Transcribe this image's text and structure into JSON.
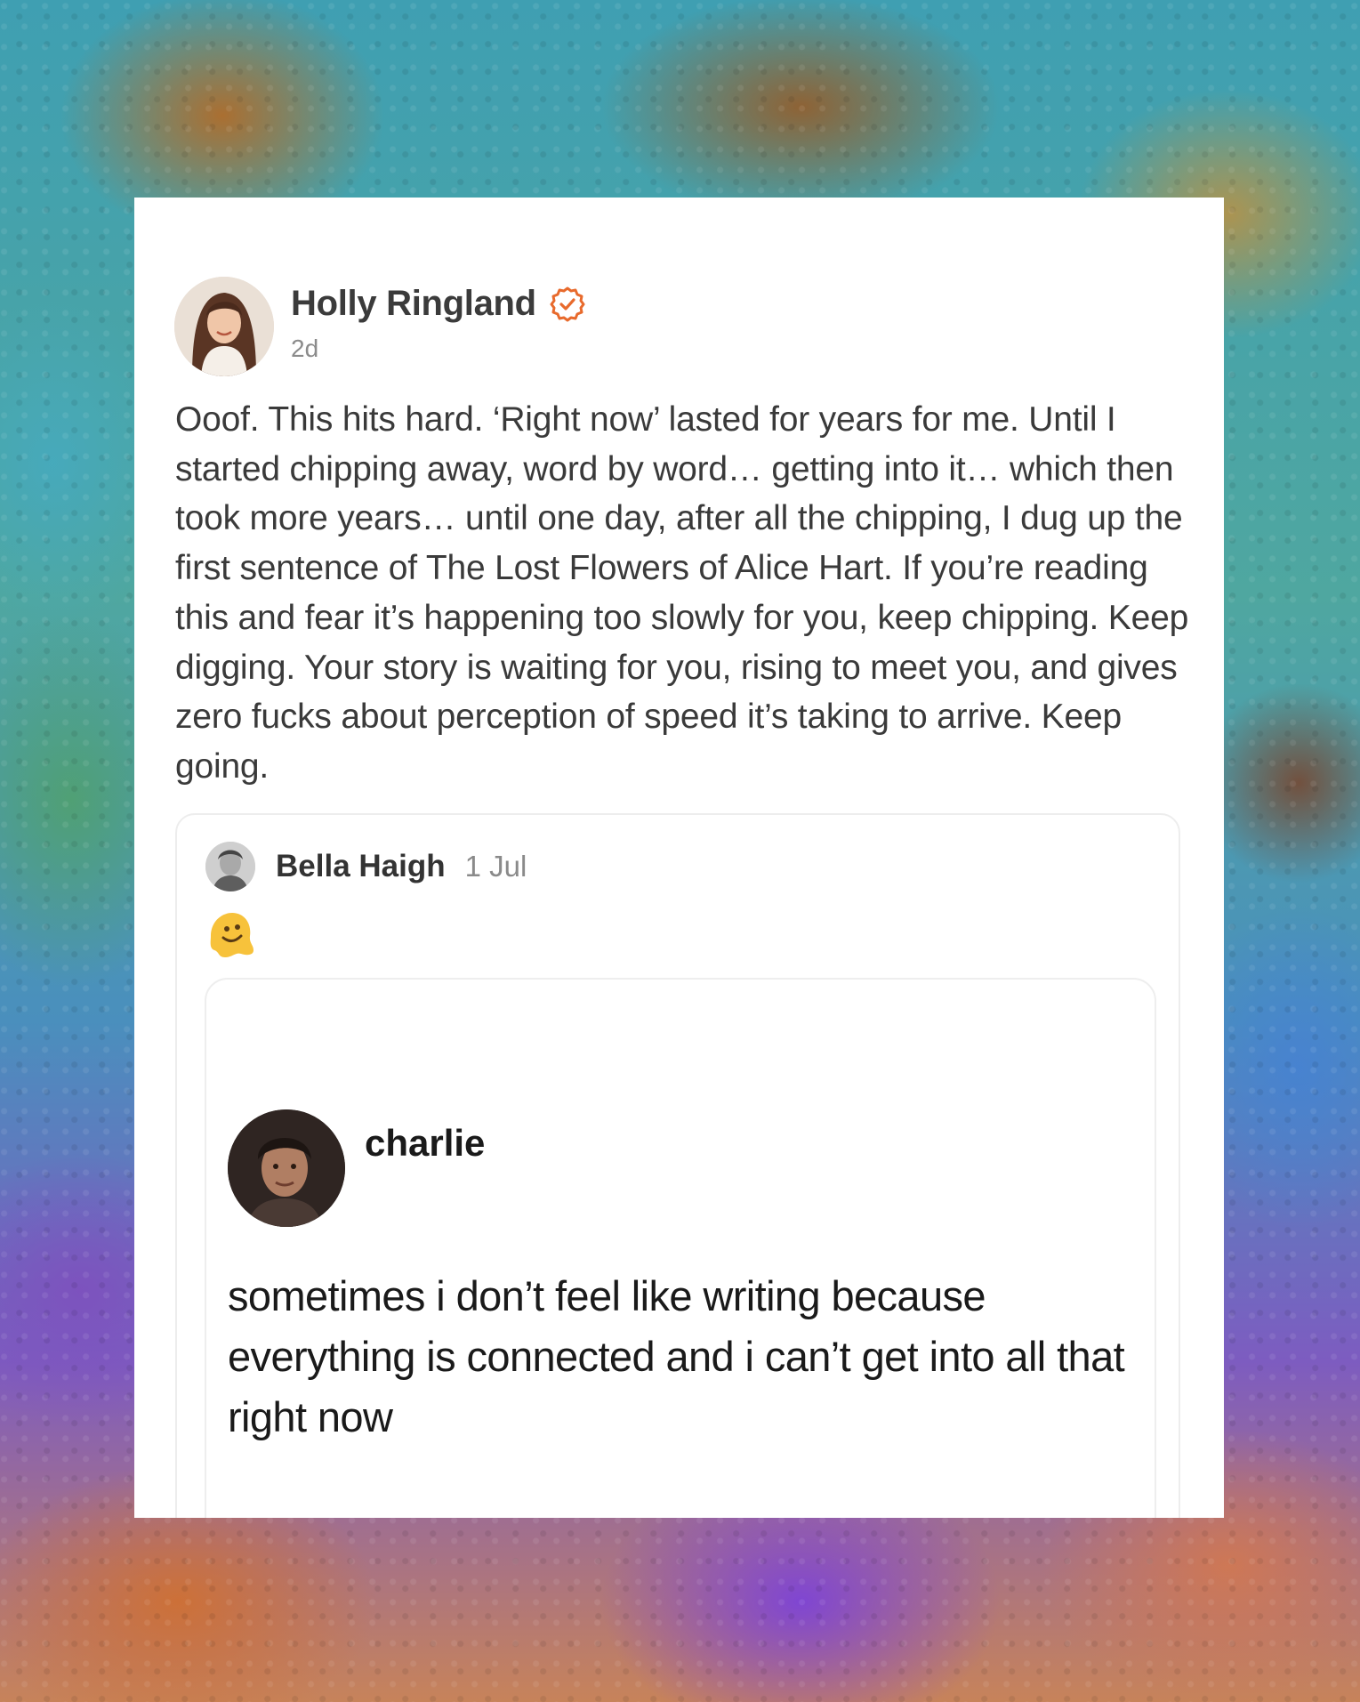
{
  "post": {
    "author": "Holly Ringland",
    "timestamp": "2d",
    "verified_icon": "verified-check-icon",
    "body": "Ooof. This hits hard. ‘Right now’ lasted for years for me. Until I started chipping away, word by word… getting into it… which then took more years… until one day, after all the chipping, I dug up the first sentence of The Lost Flowers of Alice Hart. If you’re reading this and fear it’s happening too slowly for you, keep chipping. Keep digging. Your story is waiting for you, rising to meet you, and gives zero fucks about perception of speed it’s taking to arrive. Keep going."
  },
  "quoted": {
    "author": "Bella Haigh",
    "date": "1 Jul",
    "emoji_icon": "melting-face-emoji-icon",
    "embed": {
      "author": "charlie",
      "text": "sometimes i don’t feel like writing because everything is connected and i can’t get into all that right now"
    }
  },
  "colors": {
    "verified_accent": "#e86a2c",
    "card_background": "#ffffff",
    "secondary_text": "#8b8b8b"
  }
}
